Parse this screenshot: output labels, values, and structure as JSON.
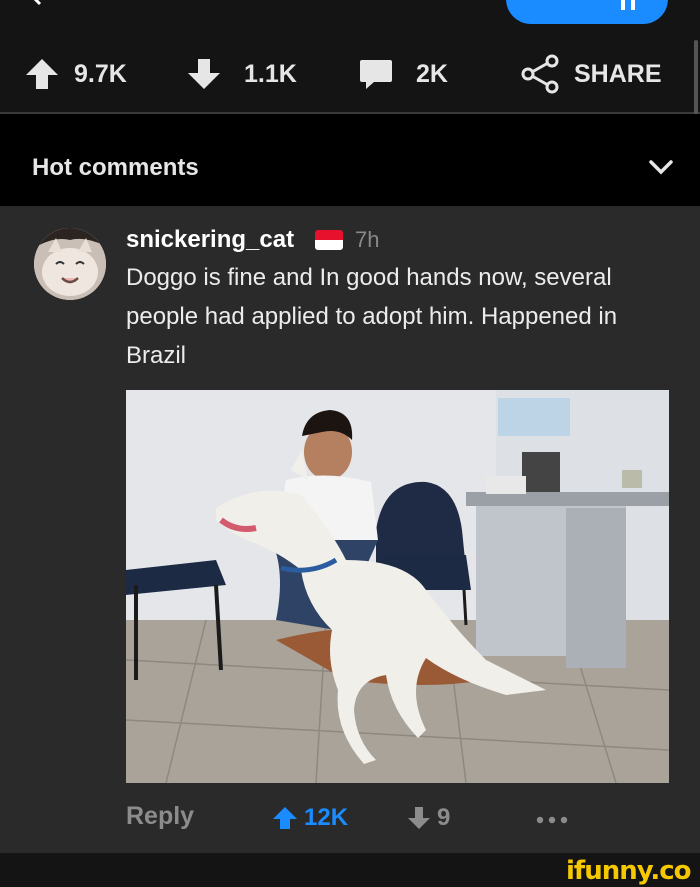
{
  "actions": {
    "upvotes": "9.7K",
    "downvotes": "1.1K",
    "comments": "2K",
    "share": "SHARE"
  },
  "section": {
    "title": "Hot comments"
  },
  "comment": {
    "username": "snickering_cat",
    "time": "7h",
    "text": "Doggo is fine and In good hands now, several people had applied to adopt him. Happened in Brazil",
    "reply": "Reply",
    "upvotes": "12K",
    "downvotes": "9"
  },
  "colors": {
    "accent": "#1a8cff",
    "watermark": "#f5c800"
  },
  "watermark": "ifunny.co"
}
